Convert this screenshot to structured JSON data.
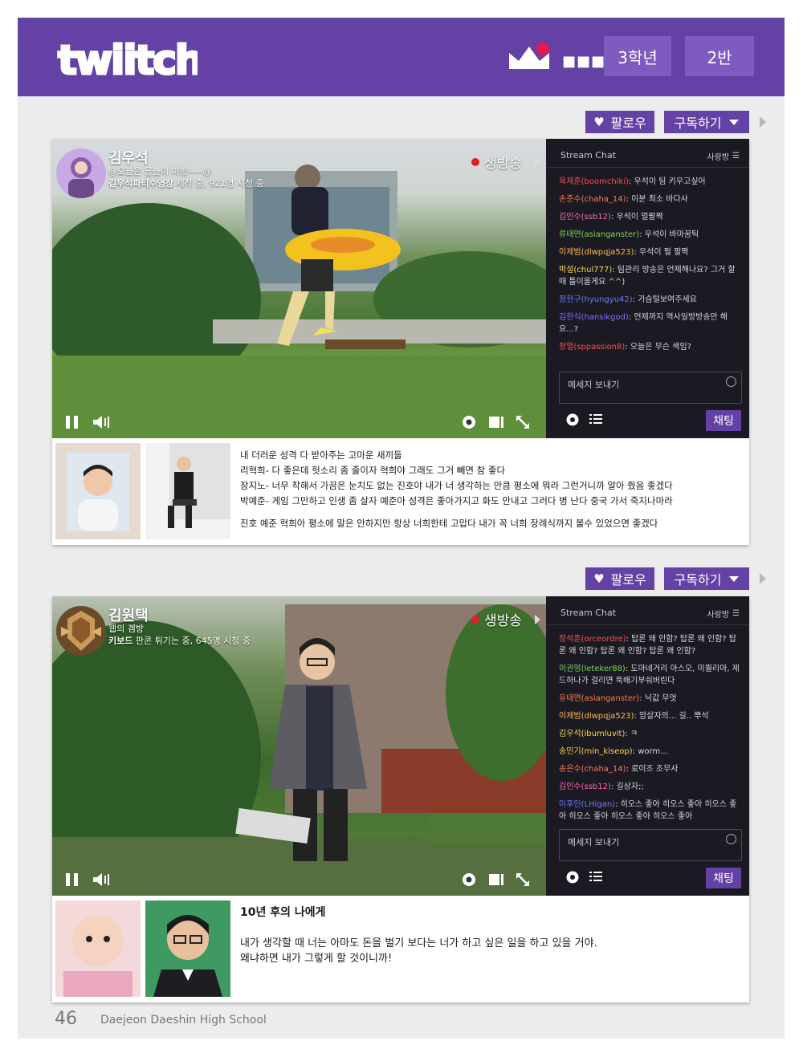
{
  "header": {
    "logo_text": "twiitch",
    "grade": "3학년",
    "class": "2반",
    "brand_color": "#6441a4",
    "notification_color": "#e5184f"
  },
  "streams": [
    {
      "follow_label": "팔로우",
      "subscribe_label": "구독하기",
      "streamer_name": "김우석",
      "status_line": "@오늘은 물놀이 야방~~@",
      "game_title": "김우석파티수영장",
      "game_suffix": " 제작 중, 921명 시청 중",
      "live_label": "생방송",
      "chat": {
        "title": "Stream Chat",
        "room_label": "사랑방",
        "messages": [
          {
            "user": "육제훈(boomchiki)",
            "color": "#ff4d4d",
            "text": ": 우석이 팀 키우고싶어"
          },
          {
            "user": "손준수(chaha_14)",
            "color": "#ff7b52",
            "text": ": 이분 최소 바다사"
          },
          {
            "user": "김인수(ssb12)",
            "color": "#ff6ab0",
            "text": ": 우석이 멀팔짝"
          },
          {
            "user": "류태연(asianganster)",
            "color": "#7fd35a",
            "text": ": 우석이 바마꿈틱"
          },
          {
            "user": "이제범(dlwpqja523)",
            "color": "#ffb84d",
            "text": ": 우석이 펄 팔짝"
          },
          {
            "user": "박설(chul777)",
            "color": "#ffd54d",
            "text": ": 팀관리 방송은 언제해나요? 그거 할때 틀이올게요 ^^)"
          },
          {
            "user": "정현구(hyungyu42)",
            "color": "#6b7cff",
            "text": ": 가슴털보여주세요"
          },
          {
            "user": "김한식(hansikgod)",
            "color": "#8a6bff",
            "text": ": 언제까지 역사일방방송만 해요...?"
          },
          {
            "user": "정열(sppassion8)",
            "color": "#ff4d4d",
            "text": ": 오늘은 무슨 색임?"
          }
        ],
        "input_placeholder": "메세지 보내기",
        "send_label": "채팅"
      },
      "message_lines": [
        "내 더러운 성격 다 받아주는 고마운 새끼들",
        "리혁희- 다 좋은데 헛소리 좀 줄이자 혁희야 그래도 그거 빼면 참 좋다",
        "장지노- 너무 착해서 가끔은 눈치도 없는 진호야 내가 너 생각하는 만큼 평소에 뭐라 그런거니까 알아 줬음 좋겠다",
        "박예준- 게임 그만하고 인생 좀 살자 예준아 성격은 좋아가지고 화도 안내고 그러다 병 난다 중국 가서 죽지나마라",
        "진호 예준 혁희아 평소에 말은 안하지만 항상 너희한테 고맙다 내가 꼭 너희 장례식까지 볼수 있었으면 좋겠다"
      ]
    },
    {
      "follow_label": "팔로우",
      "subscribe_label": "구독하기",
      "streamer_name": "김원택",
      "status_line": "웹의 겜방",
      "game_title": "키보드",
      "game_suffix": " 판콘 튀기는 중, 645명 시청 중",
      "live_label": "생방송",
      "chat": {
        "title": "Stream Chat",
        "room_label": "사랑방",
        "messages": [
          {
            "user": "장석훈(orceordre)",
            "color": "#ff4d4d",
            "text": ": 탑론 왜 인함? 탑론 왜 인함? 탑론 왜 인함? 탑론 왜 인함? 탑론 왜 인함?"
          },
          {
            "user": "이권영(leteker88)",
            "color": "#7fd35a",
            "text": ": 도마네거리 아스오, 미퀄리아, 제드하나가 걸리면 뚝배기부숴버린다"
          },
          {
            "user": "유태연(asianganster)",
            "color": "#ff7b52",
            "text": ": 닉값 무엇"
          },
          {
            "user": "이제범(dlwpqja523)",
            "color": "#ffb84d",
            "text": ": 암살자의... 길.. 뿌석"
          },
          {
            "user": "김우석(ibumluvit)",
            "color": "#ffd54d",
            "text": ": ㅋ"
          },
          {
            "user": "송민기(min_kiseop)",
            "color": "#ffd54d",
            "text": ": worm..."
          },
          {
            "user": "송은수(chaha_14)",
            "color": "#ff7b52",
            "text": ": 로이조 조무사"
          },
          {
            "user": "김인수(ssb12)",
            "color": "#ff6ab0",
            "text": ": 길상자;;"
          },
          {
            "user": "이후인(LHigan)",
            "color": "#6b7cff",
            "text": ": 히오스 좋아 히오스 좋아 히오스 좋아 히오스 좋아 히오스 좋아 히오스 좋아"
          }
        ],
        "input_placeholder": "메세지 보내기",
        "send_label": "채팅"
      },
      "letter_title": "10년 후의 나에게",
      "message_lines": [
        "내가 생각할 때 너는 아마도 돈을 벌기 보다는 너가 하고 싶은 일을 하고 있을 거야.",
        "왜냐하면 내가 그렇게 할 것이니까!"
      ]
    }
  ],
  "footer": {
    "page_number": "46",
    "school": "Daejeon Daeshin High School"
  }
}
